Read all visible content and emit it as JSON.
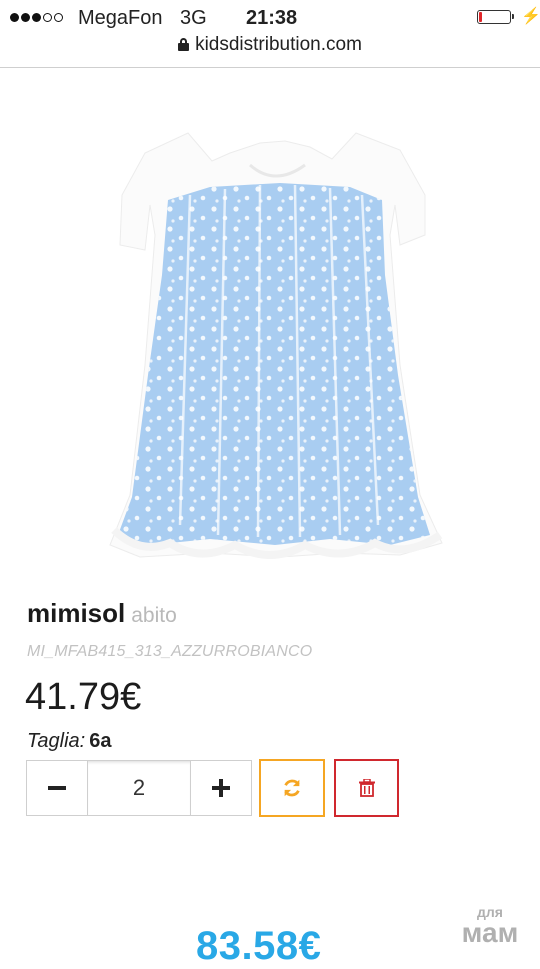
{
  "status_bar": {
    "signal_filled": 3,
    "signal_total": 5,
    "carrier": "MegaFon",
    "network": "3G",
    "time": "21:38",
    "battery_level": 0.12,
    "battery_color": "#e0262a"
  },
  "browser": {
    "url": "kidsdistribution.com"
  },
  "product": {
    "image_alt": "light blue dress with white lace overlay",
    "brand": "mimisol",
    "category": "abito",
    "sku": "MI_MFAB415_313_AZZURROBIANCO",
    "price": "41.79€",
    "size_label": "Taglia:",
    "size_value": "6a"
  },
  "cart_controls": {
    "quantity": "2",
    "refresh_color": "#f5a623",
    "delete_color": "#d0282e"
  },
  "summary": {
    "total": "83.58€",
    "total_color": "#29a8e6"
  },
  "watermark": {
    "line1": "для",
    "line2": "мам"
  }
}
